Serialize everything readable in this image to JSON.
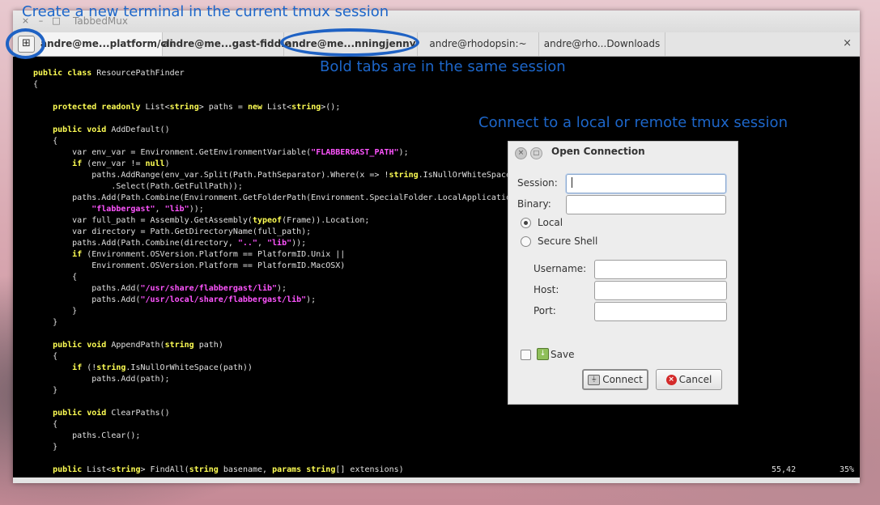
{
  "window": {
    "title": "TabbedMux",
    "controls": [
      "×",
      "–",
      "□"
    ]
  },
  "tabs": [
    {
      "label": "andre@me...platform/cli",
      "bold": true
    },
    {
      "label": "andre@me...gast-fiddle",
      "bold": true
    },
    {
      "label": "andre@me...nningjenny",
      "bold": true
    },
    {
      "label": "andre@rhodopsin:~",
      "bold": false
    },
    {
      "label": "andre@rho...Downloads",
      "bold": false
    }
  ],
  "tabbar": {
    "new_terminal_icon": "⊞",
    "close_icon": "×"
  },
  "annotations": {
    "new_terminal": "Create a new terminal in the current tmux session",
    "bold_tabs": "Bold tabs are in the same session",
    "connect": "Connect to a local or remote tmux session"
  },
  "terminal": {
    "lines": [
      [
        [
          "k",
          "public class "
        ],
        [
          "p",
          "ResourcePathFinder"
        ]
      ],
      [
        [
          "p",
          "{"
        ]
      ],
      [
        [
          "p",
          ""
        ]
      ],
      [
        [
          "p",
          "    "
        ],
        [
          "k",
          "protected readonly "
        ],
        [
          "p",
          "List<"
        ],
        [
          "k",
          "string"
        ],
        [
          "p",
          "> paths = "
        ],
        [
          "k",
          "new "
        ],
        [
          "p",
          "List<"
        ],
        [
          "k",
          "string"
        ],
        [
          "p",
          ">();"
        ]
      ],
      [
        [
          "p",
          ""
        ]
      ],
      [
        [
          "p",
          "    "
        ],
        [
          "k",
          "public void "
        ],
        [
          "p",
          "AddDefault()"
        ]
      ],
      [
        [
          "p",
          "    {"
        ]
      ],
      [
        [
          "p",
          "        var env_var = Environment.GetEnvironmentVariable("
        ],
        [
          "s",
          "\"FLABBERGAST_PATH\""
        ],
        [
          "p",
          ");"
        ]
      ],
      [
        [
          "p",
          "        "
        ],
        [
          "k",
          "if "
        ],
        [
          "p",
          "(env_var != "
        ],
        [
          "k",
          "null"
        ],
        [
          "p",
          ")"
        ]
      ],
      [
        [
          "p",
          "            paths.AddRange(env_var.Split(Path.PathSeparator).Where(x => !"
        ],
        [
          "k",
          "string"
        ],
        [
          "p",
          ".IsNullOrWhiteSpace(x))"
        ]
      ],
      [
        [
          "p",
          "                .Select(Path.GetFullPath));"
        ]
      ],
      [
        [
          "p",
          "        paths.Add(Path.Combine(Environment.GetFolderPath(Environment.SpecialFolder.LocalApplicationData),"
        ]
      ],
      [
        [
          "p",
          "            "
        ],
        [
          "s",
          "\"flabbergast\""
        ],
        [
          "p",
          ", "
        ],
        [
          "s",
          "\"lib\""
        ],
        [
          "p",
          "));"
        ]
      ],
      [
        [
          "p",
          "        var full_path = Assembly.GetAssembly("
        ],
        [
          "k",
          "typeof"
        ],
        [
          "p",
          "(Frame)).Location;"
        ]
      ],
      [
        [
          "p",
          "        var directory = Path.GetDirectoryName(full_path);"
        ]
      ],
      [
        [
          "p",
          "        paths.Add(Path.Combine(directory, "
        ],
        [
          "s",
          "\"..\""
        ],
        [
          "p",
          ", "
        ],
        [
          "s",
          "\"lib\""
        ],
        [
          "p",
          "));"
        ]
      ],
      [
        [
          "p",
          "        "
        ],
        [
          "k",
          "if "
        ],
        [
          "p",
          "(Environment.OSVersion.Platform == PlatformID.Unix ||"
        ]
      ],
      [
        [
          "p",
          "            Environment.OSVersion.Platform == PlatformID.MacOSX)"
        ]
      ],
      [
        [
          "p",
          "        {"
        ]
      ],
      [
        [
          "p",
          "            paths.Add("
        ],
        [
          "s",
          "\"/usr/share/flabbergast/lib\""
        ],
        [
          "p",
          ");"
        ]
      ],
      [
        [
          "p",
          "            paths.Add("
        ],
        [
          "s",
          "\"/usr/local/share/flabbergast/lib\""
        ],
        [
          "p",
          ");"
        ]
      ],
      [
        [
          "p",
          "        }"
        ]
      ],
      [
        [
          "p",
          "    }"
        ]
      ],
      [
        [
          "p",
          ""
        ]
      ],
      [
        [
          "p",
          "    "
        ],
        [
          "k",
          "public void "
        ],
        [
          "p",
          "AppendPath("
        ],
        [
          "k",
          "string "
        ],
        [
          "p",
          "path)"
        ]
      ],
      [
        [
          "p",
          "    {"
        ]
      ],
      [
        [
          "p",
          "        "
        ],
        [
          "k",
          "if "
        ],
        [
          "p",
          "(!"
        ],
        [
          "k",
          "string"
        ],
        [
          "p",
          ".IsNullOrWhiteSpace(path))"
        ]
      ],
      [
        [
          "p",
          "            paths.Add(path);"
        ]
      ],
      [
        [
          "p",
          "    }"
        ]
      ],
      [
        [
          "p",
          ""
        ]
      ],
      [
        [
          "p",
          "    "
        ],
        [
          "k",
          "public void "
        ],
        [
          "p",
          "ClearPaths()"
        ]
      ],
      [
        [
          "p",
          "    {"
        ]
      ],
      [
        [
          "p",
          "        paths.Clear();"
        ]
      ],
      [
        [
          "p",
          "    }"
        ]
      ],
      [
        [
          "p",
          ""
        ]
      ],
      [
        [
          "p",
          "    "
        ],
        [
          "k",
          "public "
        ],
        [
          "p",
          "List<"
        ],
        [
          "k",
          "string"
        ],
        [
          "p",
          "> FindAll("
        ],
        [
          "k",
          "string "
        ],
        [
          "p",
          "basename, "
        ],
        [
          "k",
          "params string"
        ],
        [
          "p",
          "[] extensions)"
        ]
      ]
    ],
    "cursor_position": "55,42",
    "scroll_percent": "35%"
  },
  "dialog": {
    "title": "Open Connection",
    "session_label": "Session:",
    "session_value": "",
    "binary_label": "Binary:",
    "binary_value": "",
    "local_label": "Local",
    "local_checked": true,
    "ssh_label": "Secure Shell",
    "ssh_checked": false,
    "username_label": "Username:",
    "host_label": "Host:",
    "port_label": "Port:",
    "save_label": "Save",
    "save_checked": false,
    "connect_label": "Connect",
    "cancel_label": "Cancel"
  }
}
